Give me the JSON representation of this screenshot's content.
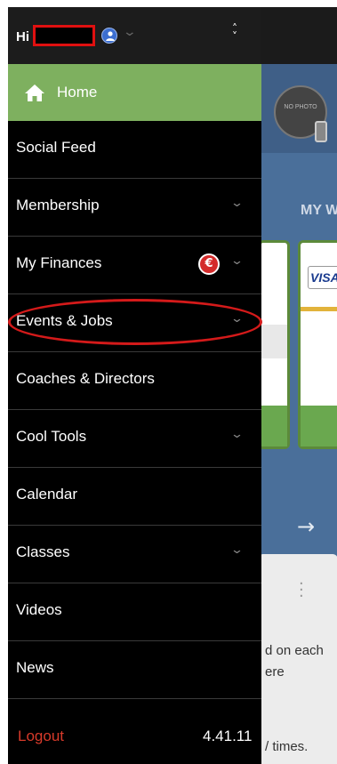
{
  "header": {
    "greeting": "Hi",
    "expand_icon": "chevron-down-icon",
    "account_icon": "user-shield-icon",
    "switch_icon": "up-down-chevron-icon"
  },
  "menu": {
    "home_label": "Home",
    "items": [
      {
        "label": "Social Feed",
        "has_submenu": false
      },
      {
        "label": "Membership",
        "has_submenu": true
      },
      {
        "label": "My Finances",
        "has_submenu": true,
        "badge": "€"
      },
      {
        "label": "Events & Jobs",
        "has_submenu": true
      },
      {
        "label": "Coaches & Directors",
        "has_submenu": false
      },
      {
        "label": "Cool Tools",
        "has_submenu": true
      },
      {
        "label": "Calendar",
        "has_submenu": false
      },
      {
        "label": "Classes",
        "has_submenu": true
      },
      {
        "label": "Videos",
        "has_submenu": false
      },
      {
        "label": "News",
        "has_submenu": false
      }
    ],
    "logout_label": "Logout",
    "version": "4.41.11"
  },
  "background": {
    "avatar_text": "NO PHOTO",
    "section_title": "MY W",
    "card_brand": "VISA",
    "text_line_1": "d on each",
    "text_line_2": "ere",
    "text_line_3": "/ times."
  },
  "colors": {
    "home_bg": "#7eb05f",
    "drawer_bg": "#000000",
    "logout": "#d73a2a",
    "highlight": "#d41a1a"
  }
}
